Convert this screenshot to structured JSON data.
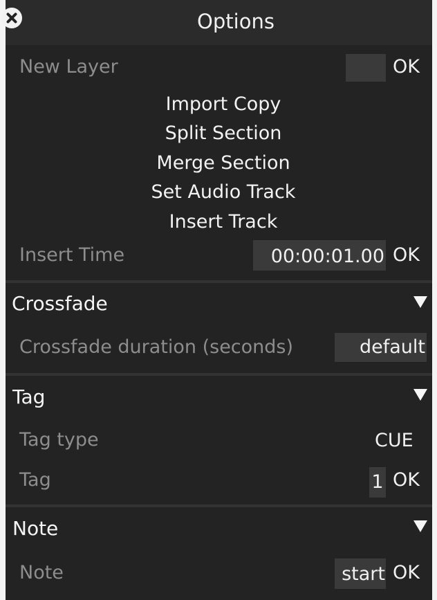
{
  "window": {
    "title": "Options"
  },
  "icons": {
    "close": "close-icon",
    "collapse": "triangle-down-icon"
  },
  "options": {
    "new_layer": {
      "label": "New Layer",
      "value": "",
      "ok": "OK"
    },
    "actions": [
      "Import Copy",
      "Split Section",
      "Merge Section",
      "Set Audio Track",
      "Insert Track"
    ],
    "insert_time": {
      "label": "Insert Time",
      "value": "00:00:01.00",
      "ok": "OK"
    }
  },
  "crossfade": {
    "title": "Crossfade",
    "duration": {
      "label": "Crossfade duration (seconds)",
      "value": "default"
    }
  },
  "tag": {
    "title": "Tag",
    "type": {
      "label": "Tag type",
      "value": "CUE"
    },
    "tag": {
      "label": "Tag",
      "value": "1",
      "ok": "OK"
    }
  },
  "note": {
    "title": "Note",
    "note": {
      "label": "Note",
      "value": "start",
      "ok": "OK"
    }
  },
  "colors": {
    "panel": "#232323",
    "titlebar": "#2b2b2b",
    "field": "#3a3a3a",
    "label": "#8d8d8d"
  }
}
